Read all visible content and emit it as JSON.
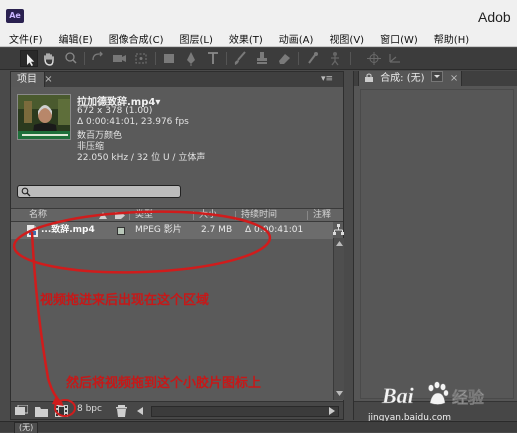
{
  "window": {
    "app_icon": "Ae",
    "title": "Adob"
  },
  "menu": [
    "文件(F)",
    "编辑(E)",
    "图像合成(C)",
    "图层(L)",
    "效果(T)",
    "动画(A)",
    "视图(V)",
    "窗口(W)",
    "帮助(H)"
  ],
  "toolbar": {
    "tools": [
      "selection-icon",
      "hand-icon",
      "zoom-icon",
      "rotate-icon",
      "camera-icon",
      "pan-behind-icon",
      "rectangle-icon",
      "pen-icon",
      "text-icon",
      "brush-icon",
      "clone-stamp-icon",
      "eraser-icon",
      "roto-brush-icon",
      "puppet-icon",
      "axis-icon"
    ]
  },
  "project_panel": {
    "tab_label": "项目",
    "tab_close": "×",
    "menu_glyph": "▾≡",
    "footage": {
      "name": "拉加德致辞.mp4▾",
      "dimensions": "672 x 378 (1.00)",
      "duration": "Δ 0:00:41:01, 23.976 fps",
      "colors": "数百万颜色",
      "compression": "非压缩",
      "audio": "22.050 kHz / 32 位 U / 立体声"
    },
    "search": {
      "icon": "search-icon",
      "value": ""
    },
    "columns": [
      "名称",
      "类型",
      "大小",
      "持续时间",
      "注释"
    ],
    "rows": [
      {
        "name": "...致辞.mp4",
        "type": "MPEG 影片",
        "size": "2.7 MB",
        "duration": "Δ 0:00:41:01"
      }
    ],
    "footer": {
      "bit_depth": "8 bpc"
    }
  },
  "composition_panel": {
    "tab_label": "合成: (无)",
    "tab_close": "×"
  },
  "annotations": {
    "drag_hint": "视频拖进来后出现在这个区域",
    "drop_hint": "然后将视频拖到这个小胶片图标上",
    "color": "#c61818"
  },
  "watermark": {
    "brand": "Bai",
    "site_cn": "经验",
    "url": "jingyan.baidu.com"
  },
  "bottom_strip": {
    "tab": "(无)"
  }
}
